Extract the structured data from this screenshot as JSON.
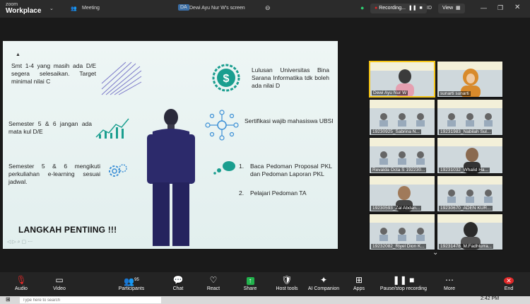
{
  "window": {
    "brand_top": "zoom",
    "brand_bottom": "Workplace",
    "meeting_label": "Meeting",
    "screen_badge": "DA",
    "screen_label": "Dewi Ayu Nur W's screen",
    "recording_label": "Recording...",
    "id_label": "ID",
    "view_label": "View"
  },
  "slide": {
    "tl_text": "Smt 1-4 yang masih ada D/E segera selesaikan. Target minimal nilai C",
    "ml_text": "Semester 5 & 6 jangan ada mata kul D/E",
    "bl_text": "Semester 5 & 6 mengikuti perkuliahan e-learning sesuai jadwal.",
    "tr_text": "Lulusan Universitas Bina Sarana Informatika tdk boleh ada nilai D",
    "mr_text": "Sertifikasi wajib mahasiswa UBSI",
    "list1": "Baca Pedoman Proposal PKL dan Pedoman Laporan PKL",
    "list2": "Pelajari Pedoman TA",
    "list1_num": "1.",
    "list2_num": "2.",
    "title": "LANGKAH PENTIING !!!"
  },
  "gallery": [
    {
      "name": "Dewi Ayu Nur W"
    },
    {
      "name": "sunarti sunarti"
    },
    {
      "name": "19230925_Sabrina N..."
    },
    {
      "name": "19231983_Nabilah Sul..."
    },
    {
      "name": "Revalda Octa S 192230..."
    },
    {
      "name": "19231032_Whalid Ha..."
    },
    {
      "name": "19230593_Zal Abdan..."
    },
    {
      "name": "19230670_ADEN KUR..."
    },
    {
      "name": "19232082_Riyel Dion K..."
    },
    {
      "name": "19231478_M.Fadhlurra..."
    }
  ],
  "toolbar": {
    "audio": "Audio",
    "video": "Video",
    "participants": "Participants",
    "participants_count": "95",
    "chat": "Chat",
    "react": "React",
    "share": "Share",
    "host_tools": "Host tools",
    "ai_companion": "AI Companion",
    "apps": "Apps",
    "pause_recording": "Pause/stop recording",
    "more": "More",
    "end": "End"
  },
  "taskbar": {
    "search_placeholder": "Type here to search",
    "time": "2:42 PM"
  },
  "colors": {
    "accent": "#2d8cff",
    "recording": "#e02828",
    "end": "#e02828",
    "slide_bg": "#e8f3f2",
    "suit": "#2c2a6b"
  }
}
